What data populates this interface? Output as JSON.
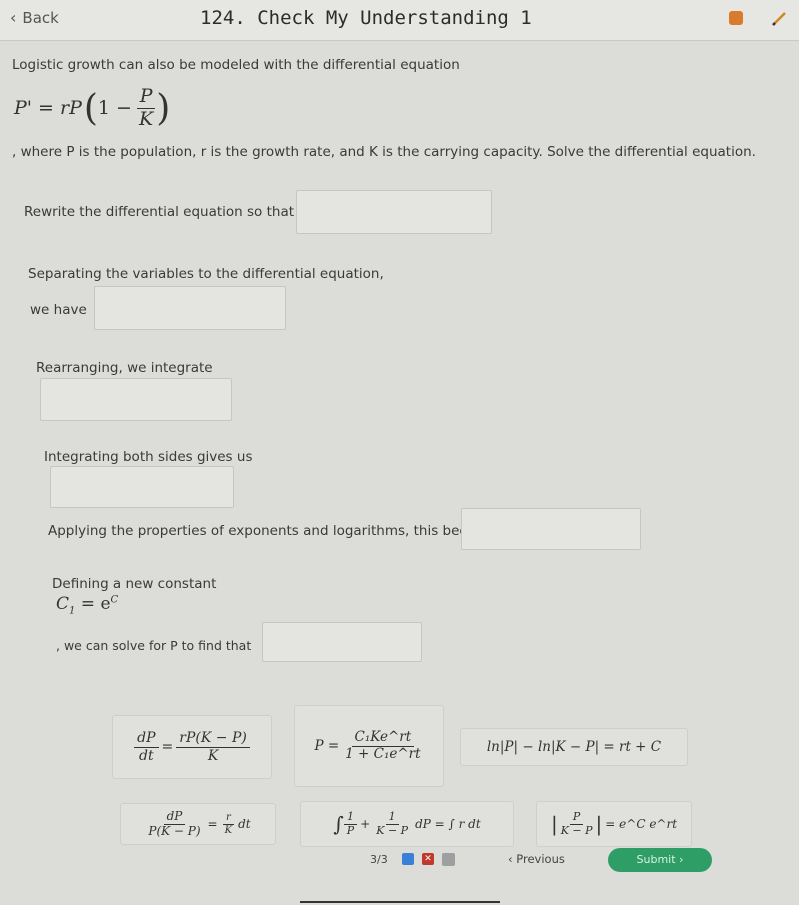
{
  "header": {
    "back_label": "Back",
    "title": "124. Check My Understanding 1"
  },
  "problem": {
    "intro": "Logistic growth can also be modeled with the differential equation",
    "equation_lhs": "P' = rP",
    "equation_paren_open": "(",
    "equation_one_minus": "1 −",
    "equation_frac_num": "P",
    "equation_frac_den": "K",
    "equation_paren_close": ")",
    "description": ", where P is the population, r is the growth rate, and K is the carrying capacity. Solve the differential equation."
  },
  "steps": {
    "rewrite": "Rewrite the differential equation so that",
    "separating": "Separating the variables to the differential equation,",
    "we_have": "we have",
    "rearranging": "Rearranging, we integrate",
    "integrating": "Integrating both sides gives us",
    "applying": "Applying the properties of exponents and logarithms, this becomes",
    "defining": "Defining a new constant",
    "const_lhs": "C",
    "const_sub": "1",
    "const_eq": "= e",
    "const_sup": "C",
    "solve_for": ", we can solve for P to find that"
  },
  "tiles": {
    "t1": {
      "num": "dP",
      "den": "dt",
      "eq": "=",
      "rnum": "rP(K − P)",
      "rden": "K"
    },
    "t2": {
      "lhs": "P =",
      "num": "C₁Ke^rt",
      "den": "1 + C₁e^rt"
    },
    "t3": {
      "text": "ln|P| − ln|K − P| = rt + C"
    },
    "t4": {
      "num": "dP",
      "den": "P(K − P)",
      "eq": "=",
      "rnum": "r",
      "rden": "K",
      "tail": "dt"
    },
    "t5": {
      "int": "∫",
      "n1": "1",
      "d1": "P",
      "plus": "+",
      "n2": "1",
      "d2": "K − P",
      "mid": "dP = ∫ r dt"
    },
    "t6": {
      "bar_l": "|",
      "num": "P",
      "den": "K − P",
      "bar_r": "|",
      "rhs": "= e^C e^rt"
    }
  },
  "footer": {
    "pager": "3/3",
    "x_mark": "✕",
    "previous": "Previous",
    "submit": "Submit"
  },
  "colors": {
    "submit": "#2f9e66",
    "check": "#3b7fd9",
    "x": "#c0392b",
    "badge": "#d97b2b"
  }
}
